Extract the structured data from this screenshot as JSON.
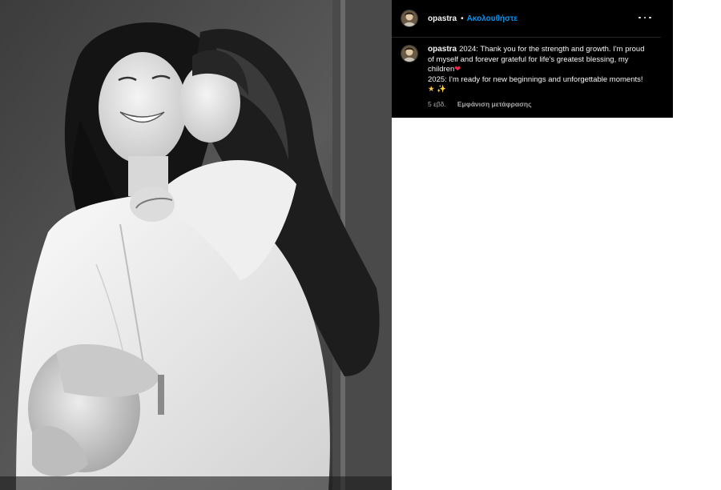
{
  "post": {
    "image_alt": "Black-and-white photo of a smiling pregnant woman holding her belly while a young girl hugs and kisses her cheek"
  },
  "header": {
    "username": "opastra",
    "separator": "•",
    "follow_label": "Ακολουθήστε",
    "more_icon": "more-options-icon"
  },
  "caption": {
    "username": "opastra",
    "line1": "2024: Thank you for the strength and growth. I'm proud",
    "line2": "of myself and forever grateful for life's greatest blessing, my",
    "line3": "children",
    "heart": "❤",
    "line4": "2025: I'm ready for new beginnings and unforgettable moments!",
    "emoji_star": "★",
    "emoji_sparkle": "✨"
  },
  "meta": {
    "time": "5 εβδ.",
    "translate_label": "Εμφάνιση μετάφρασης"
  },
  "colors": {
    "panel_bg": "#000000",
    "follow_blue": "#0095f6",
    "heart_red": "#ed2a4c",
    "meta_gray": "#a8a8a8"
  }
}
